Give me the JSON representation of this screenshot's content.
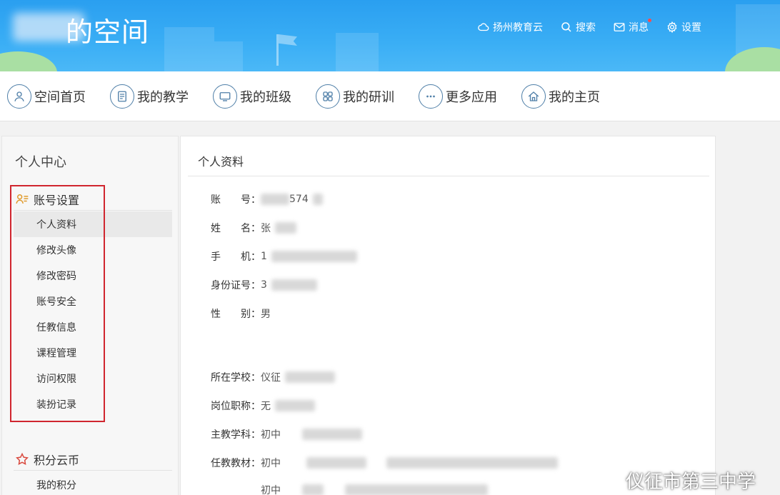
{
  "header": {
    "title": "的空间",
    "nav": [
      {
        "label": "扬州教育云",
        "icon": "cloud-icon"
      },
      {
        "label": "搜索",
        "icon": "search-icon"
      },
      {
        "label": "消息",
        "icon": "mail-icon"
      },
      {
        "label": "设置",
        "icon": "gear-icon"
      }
    ]
  },
  "main_nav": [
    {
      "label": "空间首页",
      "icon": "user-icon"
    },
    {
      "label": "我的教学",
      "icon": "book-icon"
    },
    {
      "label": "我的班级",
      "icon": "monitor-icon"
    },
    {
      "label": "我的研训",
      "icon": "grid-icon"
    },
    {
      "label": "更多应用",
      "icon": "ellipsis-icon"
    },
    {
      "label": "我的主页",
      "icon": "home-icon"
    }
  ],
  "sidebar": {
    "title": "个人中心",
    "account_group": "账号设置",
    "account_items": [
      "个人资料",
      "修改头像",
      "修改密码",
      "账号安全",
      "任教信息",
      "课程管理",
      "访问权限",
      "装扮记录"
    ],
    "points_group": "积分云币",
    "points_items": [
      "我的积分"
    ]
  },
  "profile": {
    "title": "个人资料",
    "fields": [
      {
        "label": "账　　号：",
        "value": "574"
      },
      {
        "label": "姓　　名：",
        "value": "张"
      },
      {
        "label": "手　　机：",
        "value": "1"
      },
      {
        "label": "身份证号：",
        "value": "3"
      },
      {
        "label": "性　　别：",
        "value": "男"
      },
      {
        "label": "所在学校：",
        "value": "仪征"
      },
      {
        "label": "岗位职称：",
        "value": "无"
      },
      {
        "label": "主教学科：",
        "value": "初中"
      },
      {
        "label": "任教教材：",
        "value": "初中"
      },
      {
        "label": "",
        "value": "初中"
      }
    ]
  },
  "watermark": "仪征市第三中学"
}
